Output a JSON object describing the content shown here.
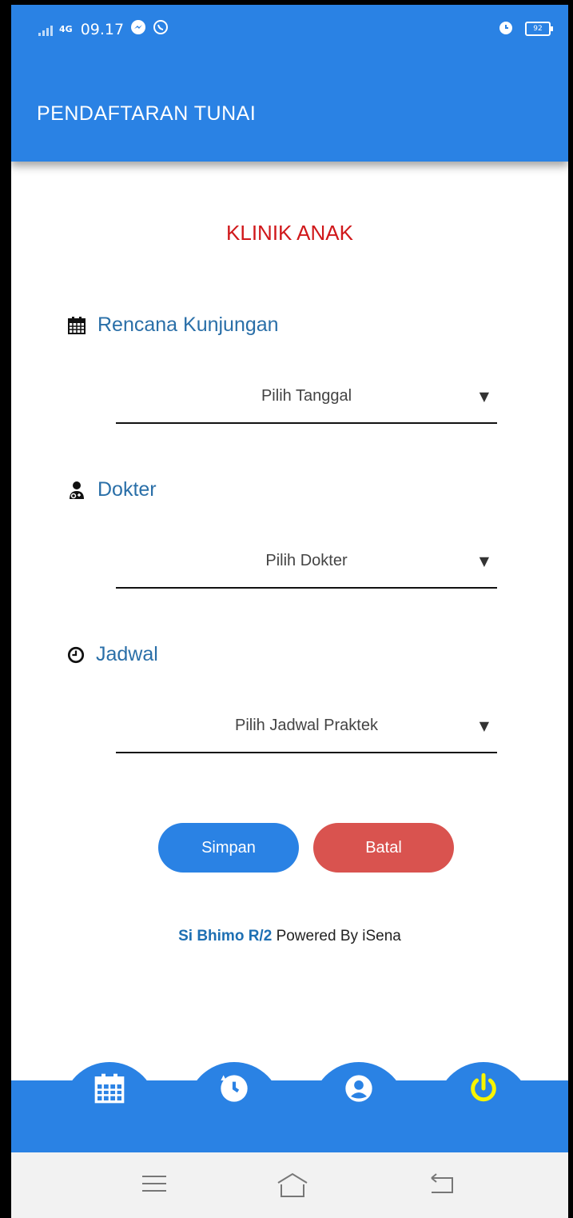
{
  "status_bar": {
    "network": "4G",
    "time": "09.17",
    "battery": "92"
  },
  "app_bar": {
    "title": "PENDAFTARAN TUNAI"
  },
  "clinic_name": "KLINIK ANAK",
  "fields": [
    {
      "label": "Rencana Kunjungan",
      "icon": "calendar-icon",
      "value": "Pilih Tanggal"
    },
    {
      "label": "Dokter",
      "icon": "doctor-icon",
      "value": "Pilih Dokter"
    },
    {
      "label": "Jadwal",
      "icon": "clock-icon",
      "value": "Pilih Jadwal Praktek"
    }
  ],
  "buttons": {
    "save": "Simpan",
    "cancel": "Batal"
  },
  "footer": {
    "brand": "Si Bhimo R/2",
    "text": "Powered By iSena"
  },
  "bottom_nav": [
    "calendar-icon",
    "history-icon",
    "profile-icon",
    "power-icon"
  ],
  "colors": {
    "primary": "#2a82e4",
    "danger": "#d9534f",
    "title_red": "#d0181b",
    "label_blue": "#2a6fa8",
    "power_yellow": "#f7f400"
  }
}
